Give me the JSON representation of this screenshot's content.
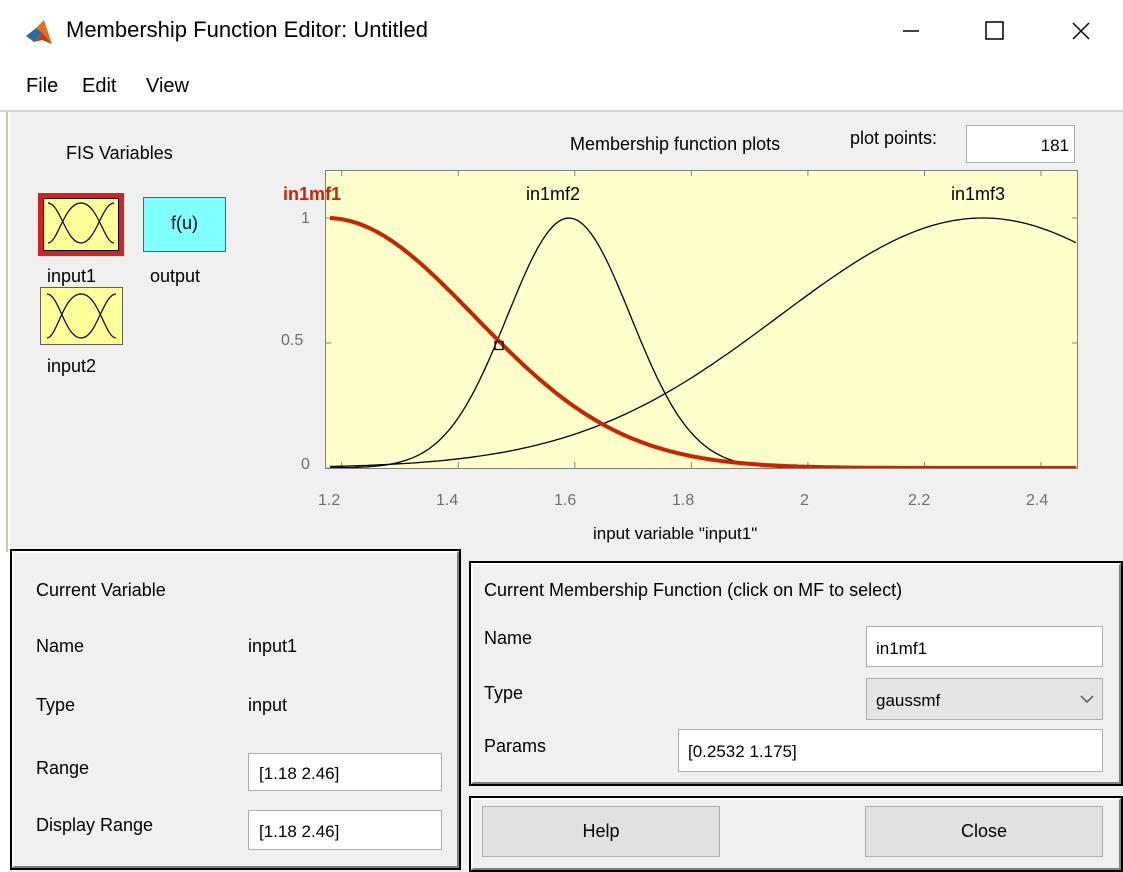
{
  "window": {
    "title": "Membership Function Editor: Untitled"
  },
  "menu": {
    "items": [
      "File",
      "Edit",
      "View"
    ]
  },
  "fis_panel": {
    "title": "FIS Variables",
    "output_box_text": "f(u)",
    "input1_label": "input1",
    "output_label": "output",
    "input2_label": "input2"
  },
  "plot_header": {
    "title": "Membership function plots",
    "plot_points_label": "plot points:",
    "plot_points_value": "181"
  },
  "chart_data": {
    "type": "line",
    "xlabel": "input variable \"input1\"",
    "xlim": [
      1.18,
      2.46
    ],
    "ylim": [
      0,
      1
    ],
    "x_ticks": [
      "1.2",
      "1.4",
      "1.6",
      "1.8",
      "2",
      "2.2",
      "2.4"
    ],
    "y_ticks": [
      "0",
      "0.5",
      "1"
    ],
    "series": [
      {
        "name": "in1mf1",
        "type": "gaussmf",
        "sigma": 0.2532,
        "center": 1.175,
        "selected": true,
        "color": "#cc2200"
      },
      {
        "name": "in1mf2",
        "type": "gaussmf",
        "sigma": 0.106,
        "center": 1.59,
        "selected": false,
        "color": "#000000"
      },
      {
        "name": "in1mf3",
        "type": "gaussmf",
        "sigma": 0.35,
        "center": 2.3,
        "selected": false,
        "color": "#000000"
      }
    ],
    "marker": {
      "x": 1.47,
      "y": 0.49
    }
  },
  "current_variable": {
    "title": "Current Variable",
    "name_label": "Name",
    "name_value": "input1",
    "type_label": "Type",
    "type_value": "input",
    "range_label": "Range",
    "range_value": "[1.18 2.46]",
    "display_range_label": "Display Range",
    "display_range_value": "[1.18 2.46]"
  },
  "current_mf": {
    "title": "Current Membership Function (click on MF to select)",
    "name_label": "Name",
    "name_value": "in1mf1",
    "type_label": "Type",
    "type_value": "gaussmf",
    "params_label": "Params",
    "params_value": "[0.2532 1.175]"
  },
  "buttons": {
    "help": "Help",
    "close": "Close"
  },
  "colors": {
    "plot_bg": "#ffffcc",
    "selected": "#cc2200",
    "input_box": "#ffff99",
    "output_box": "#80ffff"
  }
}
